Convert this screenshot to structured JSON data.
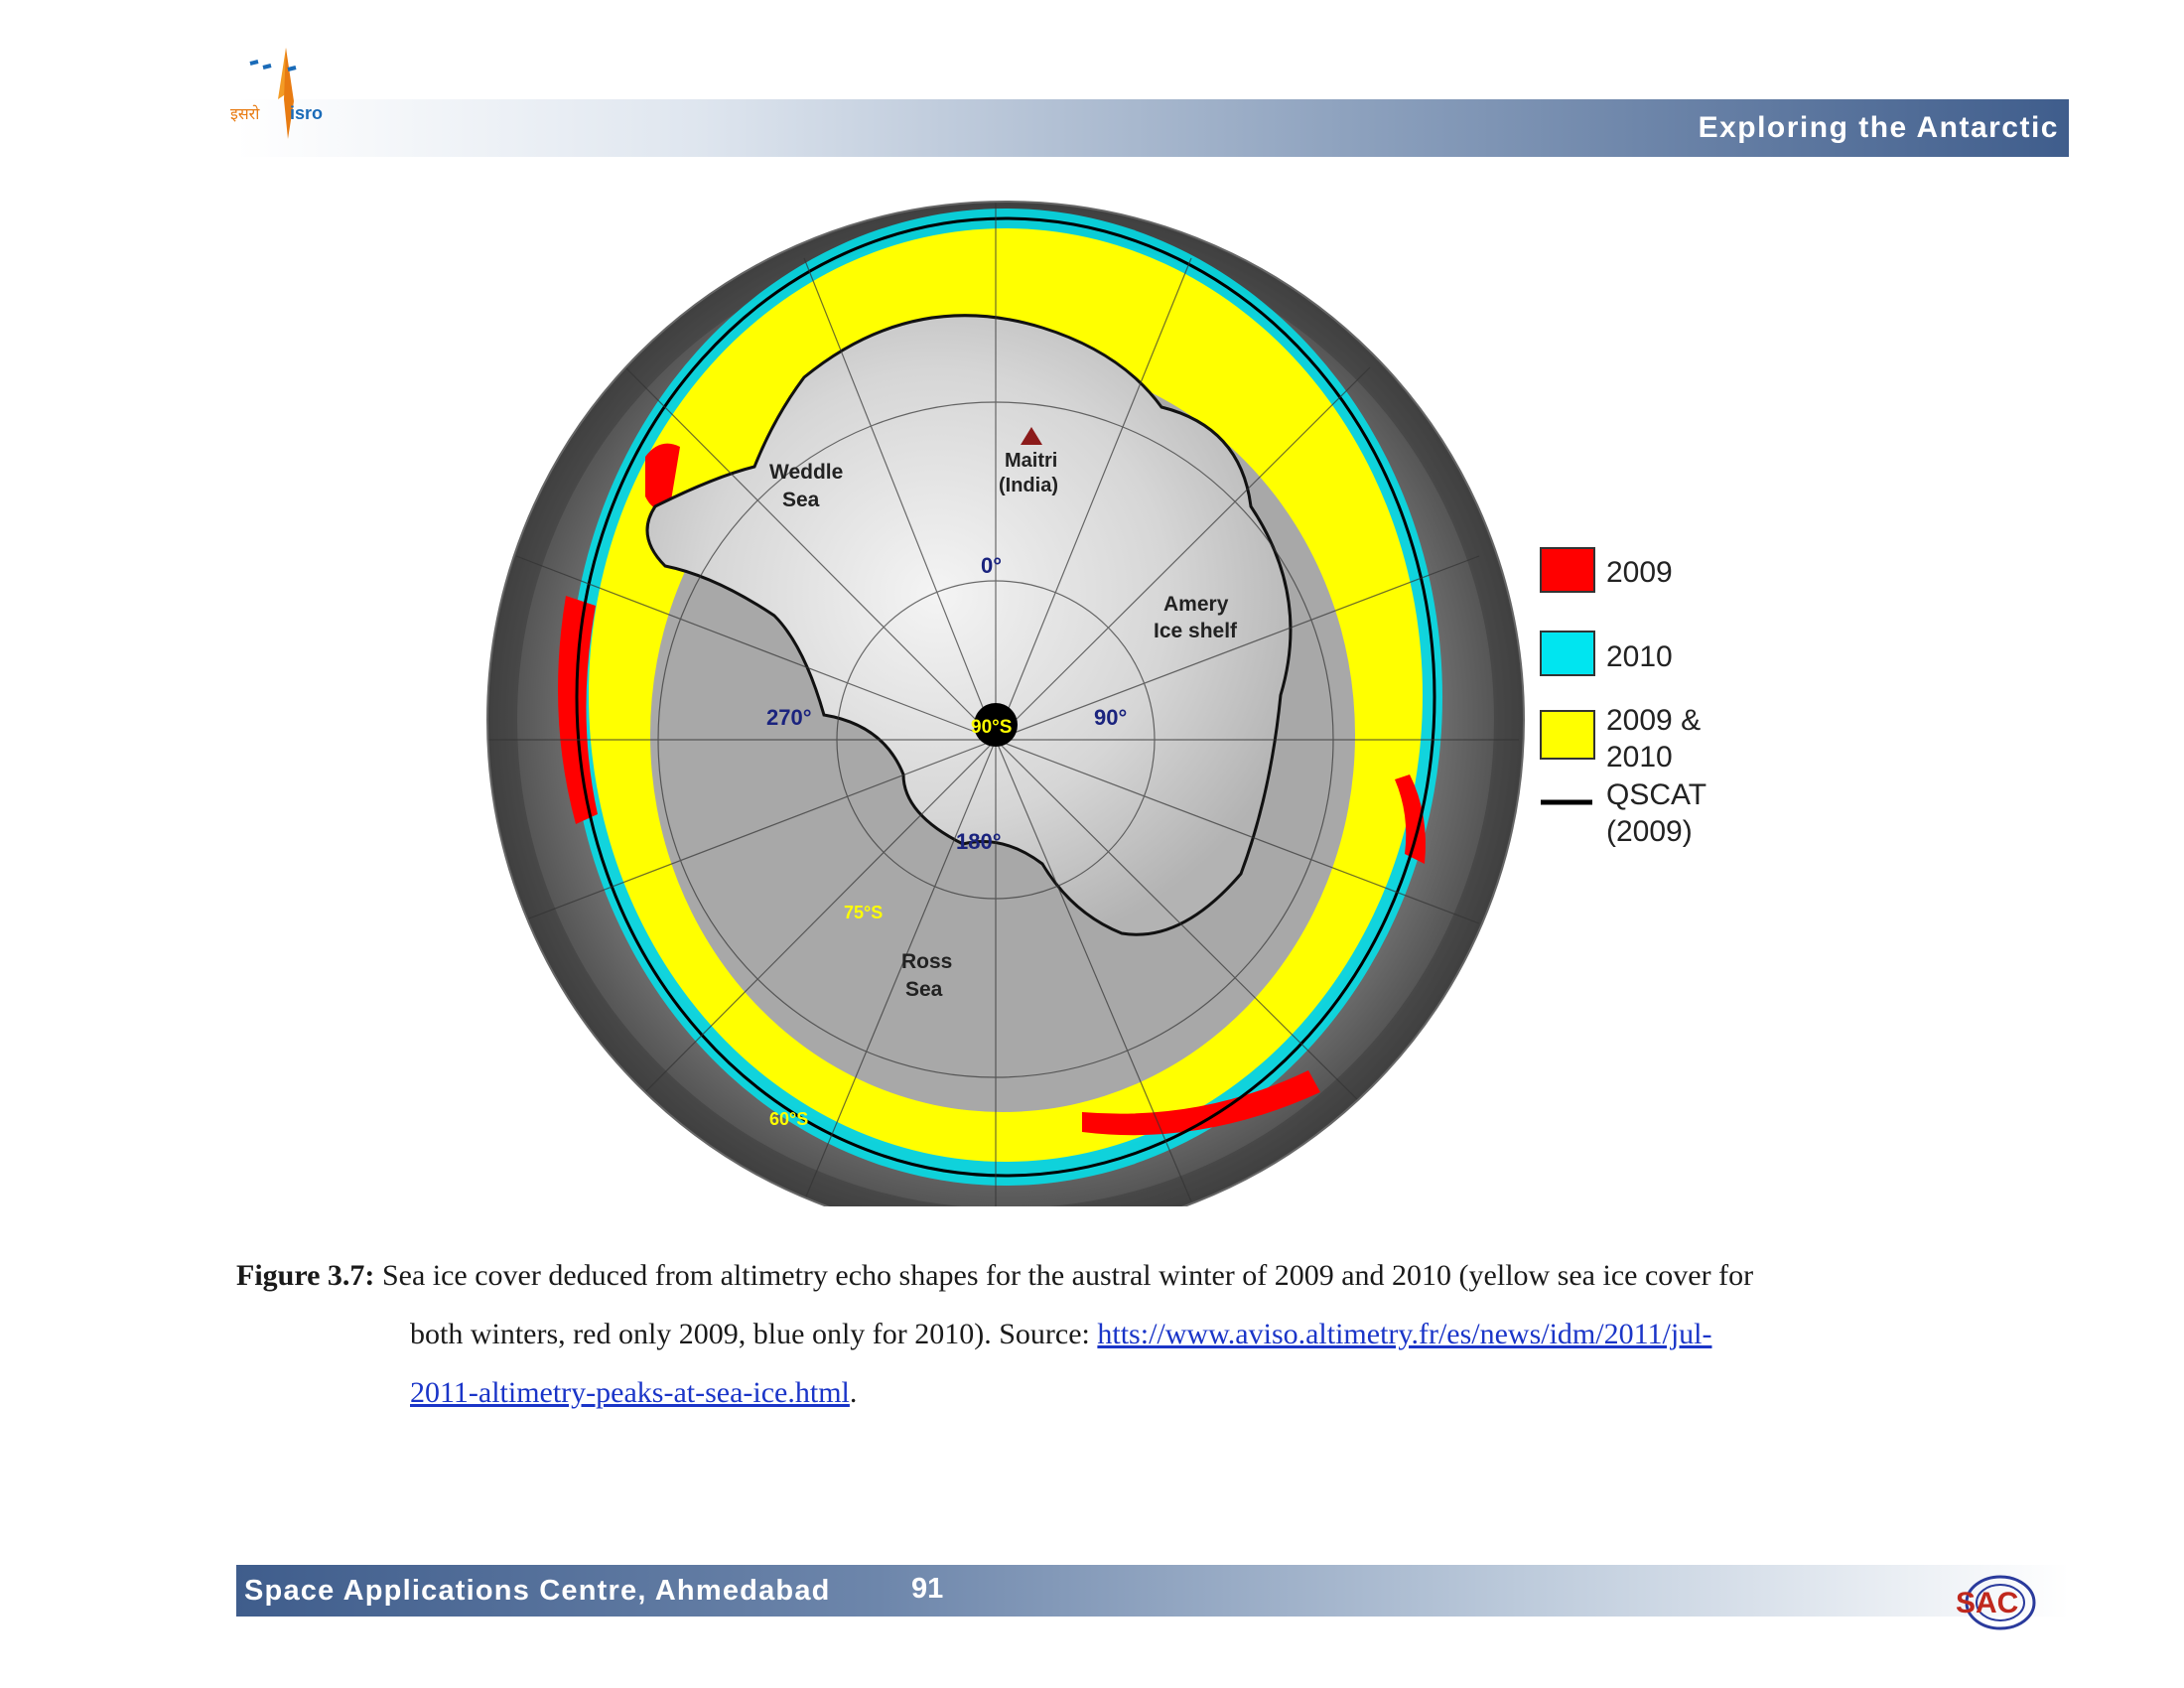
{
  "header": {
    "title": "Exploring the Antarctic"
  },
  "logos": {
    "isro_text": "इसरो isro",
    "sac_text": "SAC"
  },
  "map": {
    "labels": {
      "maitri": "Maitri",
      "maitri_country": "(India)",
      "weddle1": "Weddle",
      "weddle2": "Sea",
      "amery1": "Amery",
      "amery2": "Ice shelf",
      "lon0": "0°",
      "lon90": "90°",
      "lon180": "180°",
      "lon270": "270°",
      "pole": "90°S",
      "lat75": "75°S",
      "lat60": "60°S",
      "ross1": "Ross",
      "ross2": "Sea"
    },
    "legend": {
      "item_2009": "2009",
      "item_2010": "2010",
      "item_both1": "2009 &",
      "item_both2": "2010",
      "item_qscat1": "QSCAT",
      "item_qscat2": "(2009)"
    },
    "colors": {
      "only_2009": "#ff0000",
      "only_2010": "#00e5f0",
      "both": "#ffff00",
      "qscat": "#000000"
    }
  },
  "caption": {
    "label": "Figure 3.7:",
    "text1": "Sea ice cover deduced from altimetry echo shapes for the austral winter of 2009 and 2010 (yellow sea ice cover for",
    "text2": "both winters, red only 2009, blue only for 2010). Source: ",
    "link1": "htts://www.aviso.altimetry.fr/es/news/idm/2011/jul-",
    "link2": "2011-altimetry-peaks-at-sea-ice.html",
    "end": "."
  },
  "footer": {
    "left": "Space Applications Centre, Ahmedabad",
    "page": "91"
  }
}
